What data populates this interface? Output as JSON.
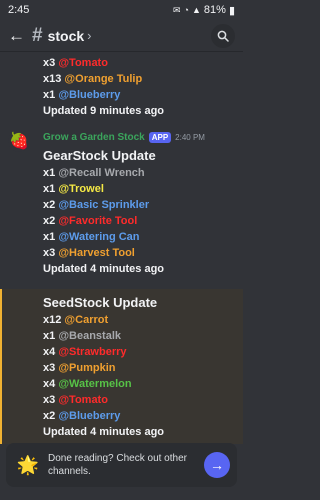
{
  "status": {
    "time": "2:45",
    "battery": "81%"
  },
  "channel": {
    "name": "stock"
  },
  "msg1": {
    "lines": [
      {
        "qty": "x3",
        "item": "@Tomato",
        "color": "#ff2b2b"
      },
      {
        "qty": "x13",
        "item": "@Orange Tulip",
        "color": "#f0a030"
      },
      {
        "qty": "x1",
        "item": "@Blueberry",
        "color": "#5d9cec"
      }
    ],
    "updated_prefix": "Updated ",
    "updated_ago": "9 minutes ago"
  },
  "msg2": {
    "author": "Grow a Garden Stock",
    "badge": "APP",
    "time": "2:40 PM",
    "title": "GearStock Update",
    "lines": [
      {
        "qty": "x1",
        "item": "@Recall Wrench",
        "color": "#a7a9ad"
      },
      {
        "qty": "x1",
        "item": "@Trowel",
        "color": "#f5e945"
      },
      {
        "qty": "x2",
        "item": "@Basic Sprinkler",
        "color": "#5d9cec"
      },
      {
        "qty": "x2",
        "item": "@Favorite Tool",
        "color": "#ff2b2b"
      },
      {
        "qty": "x1",
        "item": "@Watering Can",
        "color": "#5d9cec"
      },
      {
        "qty": "x3",
        "item": "@Harvest Tool",
        "color": "#f0a030"
      }
    ],
    "updated_prefix": "Updated ",
    "updated_ago": "4 minutes ago"
  },
  "msg3": {
    "title": "SeedStock Update",
    "lines": [
      {
        "qty": "x12",
        "item": "@Carrot",
        "color": "#f0a030"
      },
      {
        "qty": "x1",
        "item": "@Beanstalk",
        "color": "#a7a9ad"
      },
      {
        "qty": "x4",
        "item": "@Strawberry",
        "color": "#ff2b2b"
      },
      {
        "qty": "x3",
        "item": "@Pumpkin",
        "color": "#f0a030"
      },
      {
        "qty": "x4",
        "item": "@Watermelon",
        "color": "#57c247"
      },
      {
        "qty": "x3",
        "item": "@Tomato",
        "color": "#ff2b2b"
      },
      {
        "qty": "x2",
        "item": "@Blueberry",
        "color": "#5d9cec"
      }
    ],
    "updated_prefix": "Updated ",
    "updated_ago": "4 minutes ago"
  },
  "banner": {
    "text": "Done reading? Check out other channels."
  }
}
